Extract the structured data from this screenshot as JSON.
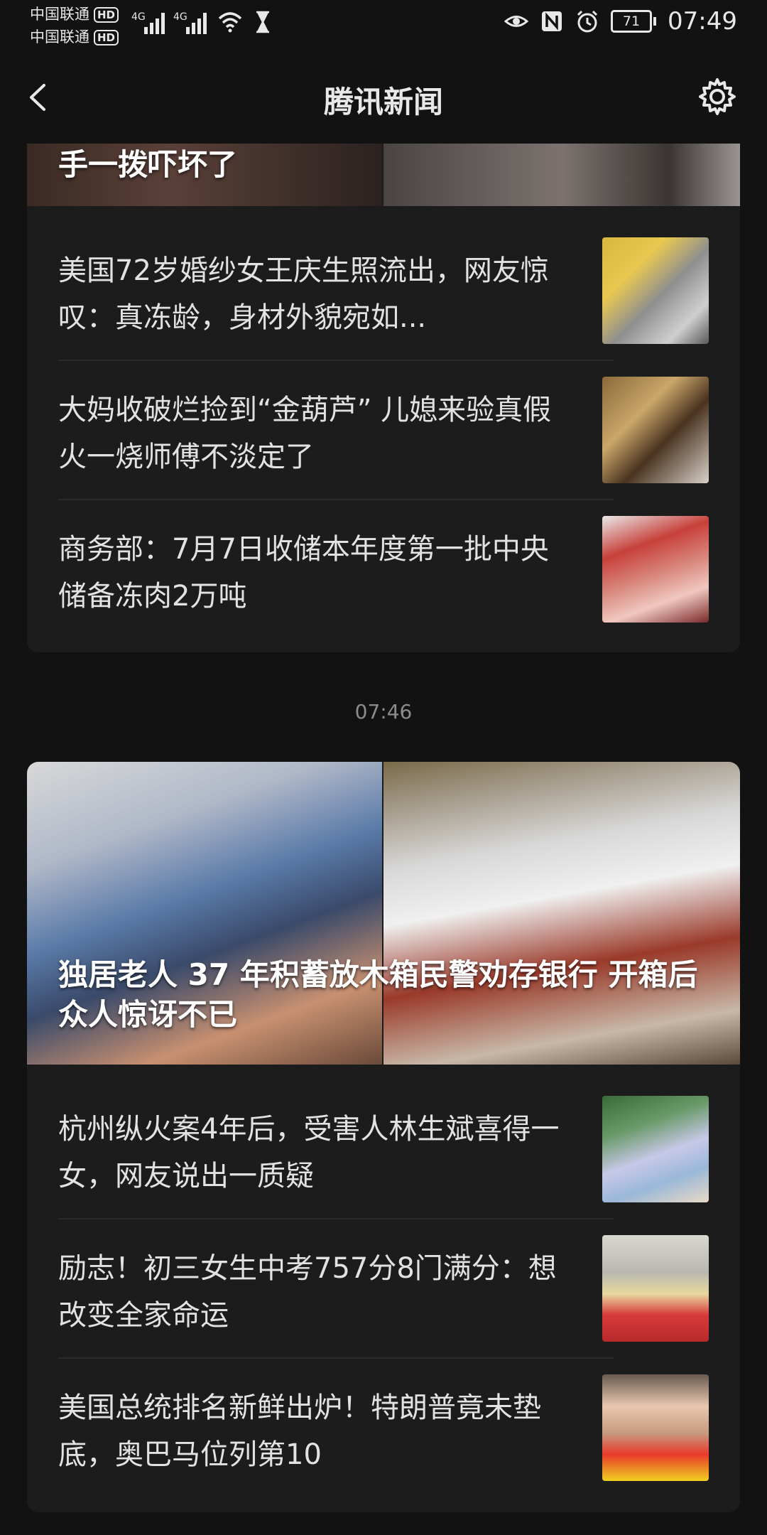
{
  "status_bar": {
    "carrier1": "中国联通",
    "carrier2": "中国联通",
    "hd_badge": "HD",
    "network": "4G",
    "battery": "71",
    "time": "07:49"
  },
  "header": {
    "title": "腾讯新闻"
  },
  "timestamp": "07:46",
  "card1": {
    "banner_title": "手一拨吓坏了",
    "items": [
      {
        "title": "美国72岁婚纱女王庆生照流出，网友惊叹：真冻龄，身材外貌宛如..."
      },
      {
        "title": "大妈收破烂捡到“金葫芦” 儿媳来验真假 火一烧师傅不淡定了"
      },
      {
        "title": "商务部：7月7日收储本年度第一批中央储备冻肉2万吨"
      }
    ]
  },
  "card2": {
    "banner_title": "独居老人 37 年积蓄放木箱民警劝存银行 开箱后众人惊讶不已",
    "items": [
      {
        "title": "杭州纵火案4年后，受害人林生斌喜得一女，网友说出一质疑"
      },
      {
        "title": "励志！初三女生中考757分8门满分：想改变全家命运"
      },
      {
        "title": "美国总统排名新鲜出炉！特朗普竟未垫底，奥巴马位列第10"
      }
    ]
  },
  "icons": {
    "back": "back-arrow-icon",
    "settings": "gear-icon",
    "eye": "eye-icon",
    "nfc": "nfc-icon",
    "alarm": "alarm-icon",
    "wifi": "wifi-icon",
    "hourglass": "hourglass-icon"
  }
}
